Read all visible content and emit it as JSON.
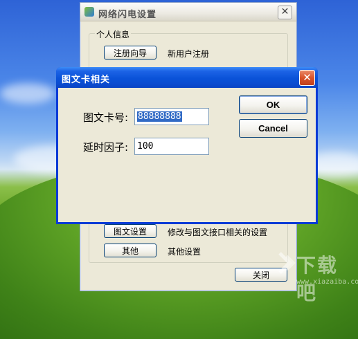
{
  "main_window": {
    "title": "网络闪电设置",
    "close_glyph": "✕",
    "group_label": "个人信息",
    "rows": [
      {
        "button": "注册向导",
        "description": "新用户注册"
      },
      {
        "button": "图文设置",
        "description": "修改与图文接口相关的设置"
      },
      {
        "button": "其他",
        "description": "其他设置"
      }
    ],
    "close_button": "关闭"
  },
  "dialog": {
    "title": "图文卡相关",
    "close_glyph": "✕",
    "card_label": "图文卡号:",
    "card_value": "88888888",
    "delay_label": "延时因子:",
    "delay_value": "100",
    "ok_label": "OK",
    "cancel_label": "Cancel"
  },
  "watermark": {
    "brand": "下载吧",
    "url": "www.xiazaiba.com"
  }
}
